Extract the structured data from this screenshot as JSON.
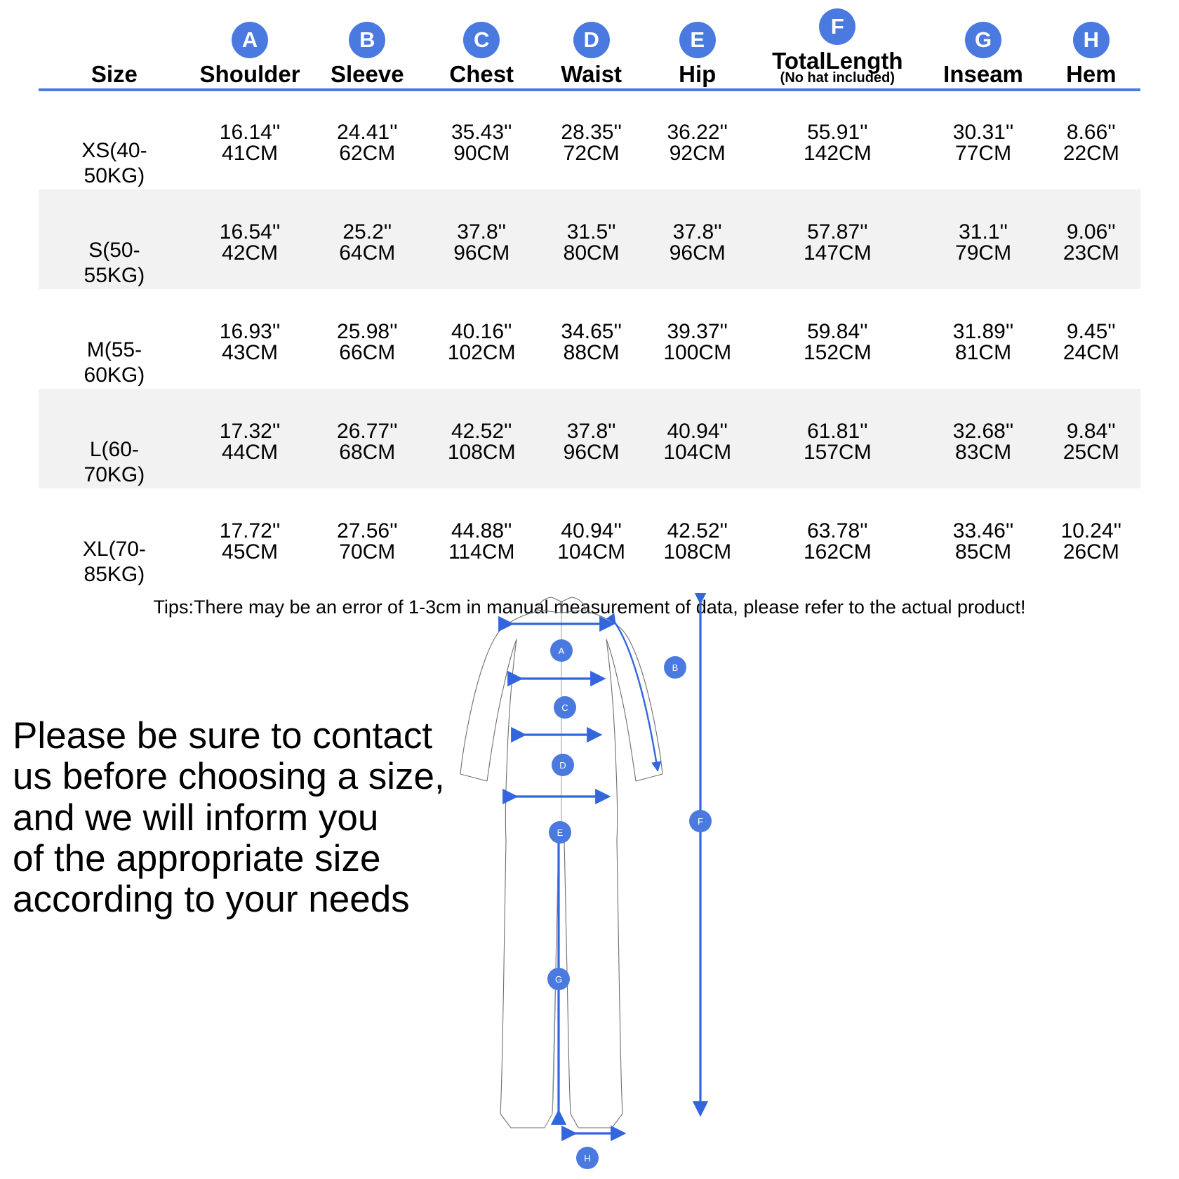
{
  "table": {
    "columns": [
      {
        "badge": "",
        "label": "Size",
        "sub": ""
      },
      {
        "badge": "A",
        "label": "Shoulder",
        "sub": ""
      },
      {
        "badge": "B",
        "label": "Sleeve",
        "sub": ""
      },
      {
        "badge": "C",
        "label": "Chest",
        "sub": ""
      },
      {
        "badge": "D",
        "label": "Waist",
        "sub": ""
      },
      {
        "badge": "E",
        "label": "Hip",
        "sub": ""
      },
      {
        "badge": "F",
        "label": "TotalLength",
        "sub": "(No hat included)"
      },
      {
        "badge": "G",
        "label": "Inseam",
        "sub": ""
      },
      {
        "badge": "H",
        "label": "Hem",
        "sub": ""
      }
    ],
    "rows": [
      {
        "size_line1": "XS(40-",
        "size_line2": "50KG)",
        "shaded": false,
        "inches": [
          "16.14''",
          "24.41''",
          "35.43''",
          "28.35''",
          "36.22''",
          "55.91''",
          "30.31''",
          "8.66''"
        ],
        "cm": [
          "41CM",
          "62CM",
          "90CM",
          "72CM",
          "92CM",
          "142CM",
          "77CM",
          "22CM"
        ]
      },
      {
        "size_line1": "S(50-",
        "size_line2": "55KG)",
        "shaded": true,
        "inches": [
          "16.54''",
          "25.2''",
          "37.8''",
          "31.5''",
          "37.8''",
          "57.87''",
          "31.1''",
          "9.06''"
        ],
        "cm": [
          "42CM",
          "64CM",
          "96CM",
          "80CM",
          "96CM",
          "147CM",
          "79CM",
          "23CM"
        ]
      },
      {
        "size_line1": "M(55-",
        "size_line2": "60KG)",
        "shaded": false,
        "inches": [
          "16.93''",
          "25.98''",
          "40.16''",
          "34.65''",
          "39.37''",
          "59.84''",
          "31.89''",
          "9.45''"
        ],
        "cm": [
          "43CM",
          "66CM",
          "102CM",
          "88CM",
          "100CM",
          "152CM",
          "81CM",
          "24CM"
        ]
      },
      {
        "size_line1": "L(60-",
        "size_line2": "70KG)",
        "shaded": true,
        "inches": [
          "17.32''",
          "26.77''",
          "42.52''",
          "37.8''",
          "40.94''",
          "61.81''",
          "32.68''",
          "9.84''"
        ],
        "cm": [
          "44CM",
          "68CM",
          "108CM",
          "96CM",
          "104CM",
          "157CM",
          "83CM",
          "25CM"
        ]
      },
      {
        "size_line1": "XL(70-",
        "size_line2": "85KG)",
        "shaded": false,
        "inches": [
          "17.72''",
          "27.56''",
          "44.88''",
          "40.94''",
          "42.52''",
          "63.78''",
          "33.46''",
          "10.24''"
        ],
        "cm": [
          "45CM",
          "70CM",
          "114CM",
          "104CM",
          "108CM",
          "162CM",
          "85CM",
          "26CM"
        ]
      }
    ],
    "tips": "Tips:There may be an error of 1-3cm in manual measurement of data, please refer to the actual product!"
  },
  "notice": {
    "line1": "Please be sure to contact",
    "line2": "us before choosing a size,",
    "line3": "and we will inform you",
    "line4": "of the appropriate size",
    "line5": "according to your needs"
  },
  "diagram": {
    "markers": [
      {
        "id": "A",
        "measures": "Shoulder"
      },
      {
        "id": "B",
        "measures": "Sleeve"
      },
      {
        "id": "C",
        "measures": "Chest"
      },
      {
        "id": "D",
        "measures": "Waist"
      },
      {
        "id": "E",
        "measures": "Hip"
      },
      {
        "id": "F",
        "measures": "TotalLength"
      },
      {
        "id": "G",
        "measures": "Inseam"
      },
      {
        "id": "H",
        "measures": "Hem"
      }
    ]
  },
  "colors": {
    "accent": "#4a7ae0",
    "arrow": "#3366dd",
    "row_shade": "#f2f2f2",
    "header_rule": "#4a7ae0",
    "text": "#000000"
  }
}
